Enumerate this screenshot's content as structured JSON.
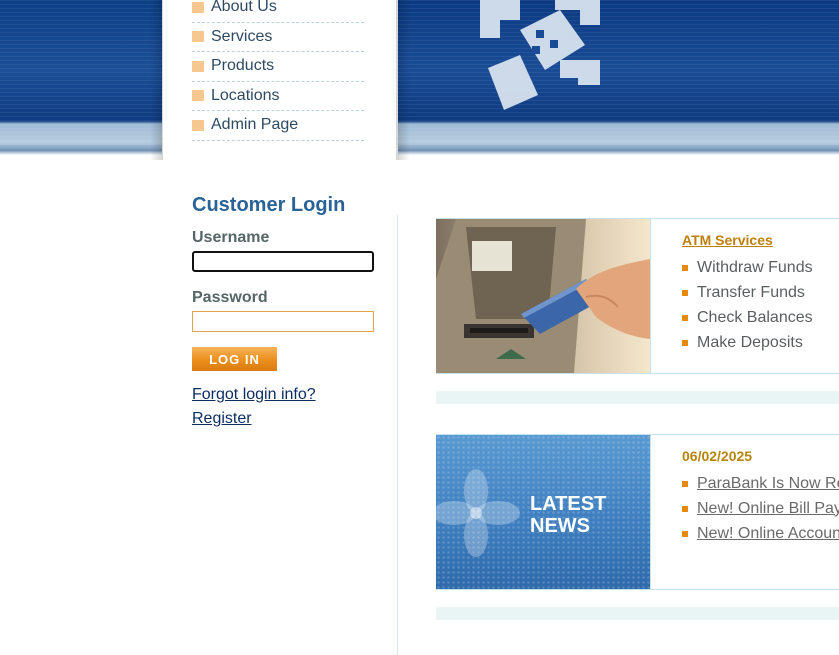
{
  "nav_menu": {
    "items": [
      {
        "label": "About Us"
      },
      {
        "label": "Services"
      },
      {
        "label": "Products"
      },
      {
        "label": "Locations"
      },
      {
        "label": "Admin Page"
      }
    ]
  },
  "login": {
    "title": "Customer Login",
    "username_label": "Username",
    "username_value": "",
    "password_label": "Password",
    "password_value": "",
    "login_button": "LOG IN",
    "forgot_link": "Forgot login info?",
    "register_link": "Register"
  },
  "atm_services": {
    "heading": "ATM Services",
    "items": [
      "Withdraw Funds",
      "Transfer Funds",
      "Check Balances",
      "Make Deposits"
    ]
  },
  "latest_news": {
    "image_caption_line1": "LATEST",
    "image_caption_line2": "NEWS",
    "date": "06/02/2025",
    "items": [
      "ParaBank Is Now Re",
      "New! Online Bill Pay",
      "New! Online Account"
    ]
  },
  "colors": {
    "banner_blue": "#0d3f86",
    "login_title": "#2a6496",
    "accent_orange": "#e58a12",
    "link_navy": "#0d2e62"
  }
}
